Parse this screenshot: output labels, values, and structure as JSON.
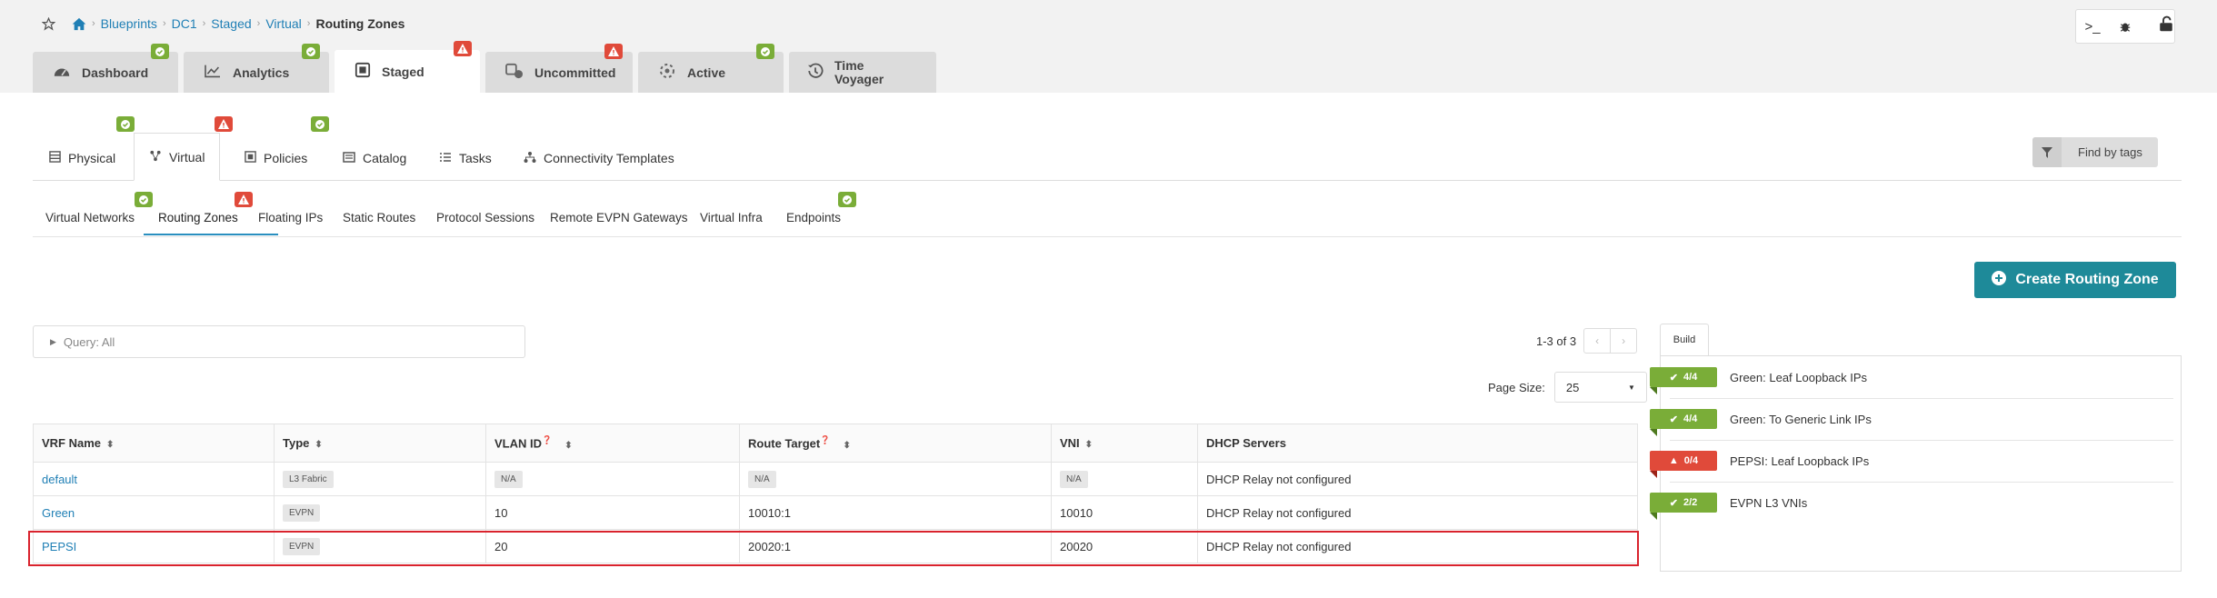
{
  "breadcrumb": {
    "items": [
      "Blueprints",
      "DC1",
      "Staged",
      "Virtual"
    ],
    "current": "Routing Zones"
  },
  "tabs": [
    {
      "label": "Dashboard",
      "status": "ok"
    },
    {
      "label": "Analytics",
      "status": "ok"
    },
    {
      "label": "Staged",
      "status": "err"
    },
    {
      "label": "Uncommitted",
      "status": "err"
    },
    {
      "label": "Active",
      "status": "ok"
    },
    {
      "label": "Time Voyager",
      "line1": "Time",
      "line2": "Voyager"
    }
  ],
  "subnav": {
    "items": [
      "Physical",
      "Virtual",
      "Policies",
      "Catalog",
      "Tasks",
      "Connectivity Templates"
    ],
    "find_by_tags": "Find by tags"
  },
  "subtabs": [
    "Virtual Networks",
    "Routing Zones",
    "Floating IPs",
    "Static Routes",
    "Protocol Sessions",
    "Remote EVPN Gateways",
    "Virtual Infra",
    "Endpoints"
  ],
  "create_button": "Create Routing Zone",
  "query": "Query: All",
  "pagination": {
    "range": "1-3 of 3",
    "page_size_label": "Page Size:",
    "page_size": "25"
  },
  "table": {
    "headers": [
      "VRF Name",
      "Type",
      "VLAN ID",
      "Route Target",
      "VNI",
      "DHCP Servers"
    ],
    "rows": [
      {
        "vrf": "default",
        "type": "L3 Fabric",
        "vlan": "N/A",
        "rt": "N/A",
        "vni": "N/A",
        "dhcp": "DHCP Relay not configured"
      },
      {
        "vrf": "Green",
        "type": "EVPN",
        "vlan": "10",
        "rt": "10010:1",
        "vni": "10010",
        "dhcp": "DHCP Relay not configured"
      },
      {
        "vrf": "PEPSI",
        "type": "EVPN",
        "vlan": "20",
        "rt": "20020:1",
        "vni": "20020",
        "dhcp": "DHCP Relay not configured"
      }
    ]
  },
  "build": {
    "tab": "Build",
    "items": [
      {
        "count": "4/4",
        "label": "Green: Leaf Loopback IPs",
        "status": "ok"
      },
      {
        "count": "4/4",
        "label": "Green: To Generic Link IPs",
        "status": "ok"
      },
      {
        "count": "0/4",
        "label": "PEPSI: Leaf Loopback IPs",
        "status": "err"
      },
      {
        "count": "2/2",
        "label": "EVPN L3 VNIs",
        "status": "ok"
      }
    ]
  },
  "colors": {
    "accent": "#1e8a99",
    "link": "#1f7fb5",
    "ok": "#7aad38",
    "error": "#e04a3a",
    "highlight": "#d9232d"
  }
}
